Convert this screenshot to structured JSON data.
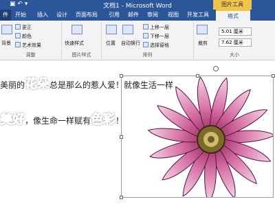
{
  "window": {
    "title": "文档1 - Microsoft Word",
    "context_tool": "图片工具",
    "qat_icons": [
      "save-icon",
      "undo-icon",
      "customize-icon"
    ]
  },
  "tabs": [
    {
      "label": "件"
    },
    {
      "label": "开始"
    },
    {
      "label": "插入"
    },
    {
      "label": "设计"
    },
    {
      "label": "页面布局"
    },
    {
      "label": "引用"
    },
    {
      "label": "邮件"
    },
    {
      "label": "审阅"
    },
    {
      "label": "视图"
    },
    {
      "label": "开发工具"
    },
    {
      "label": "格式"
    }
  ],
  "ribbon": {
    "adjust": {
      "label": "调整",
      "background": "背景",
      "correct": "更正",
      "color": "颜色",
      "artistic": "艺术效果"
    },
    "styles": {
      "label": "图片样式",
      "quick": "快速样式"
    },
    "arrange": {
      "label": "排列",
      "position": "位置",
      "wrap": "自动换行",
      "forward": "上移一层",
      "backward": "下移一层",
      "pane": "选择窗格"
    },
    "size": {
      "label": "大小",
      "crop": "裁剪",
      "height": "5.01 厘米",
      "width": "7.62 厘米"
    }
  },
  "document": {
    "line1_a": "美丽的",
    "line1_big": "花朵",
    "line1_b": "总是那么的惹人爱！就像生活一样",
    "line2_big1": "美好",
    "line2_a": "，像生命一样赋有",
    "line2_big2": "色彩",
    "line2_b": "！"
  }
}
